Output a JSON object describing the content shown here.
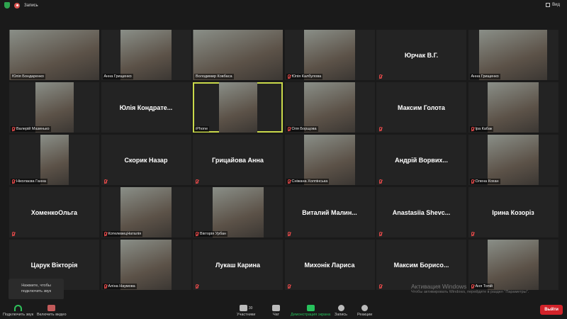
{
  "header": {
    "recording_label": "Запись",
    "view_label": "Вид"
  },
  "tiles": [
    {
      "name": "Юлія Бондаренко",
      "video": true,
      "w": 127,
      "muted": false
    },
    {
      "name": "Анна Грищенко",
      "video": true,
      "w": 72,
      "muted": false
    },
    {
      "name": "Володимир Ковбаса",
      "video": true,
      "w": 127,
      "muted": false
    },
    {
      "name": "Юлія Калбулова",
      "video": true,
      "w": 72,
      "muted": true
    },
    {
      "name": "Юрчак В.Г.",
      "video": false,
      "muted": true
    },
    {
      "name": "Анна Грищенко",
      "video": true,
      "w": 96,
      "muted": false
    },
    {
      "name": "Валерій Мазинько",
      "video": true,
      "w": 54,
      "muted": true
    },
    {
      "name": "Юлія Кондрате...",
      "video": false,
      "muted": false
    },
    {
      "name": "iPhone",
      "video": true,
      "w": 54,
      "muted": false,
      "active": true
    },
    {
      "name": "Оля Борщова",
      "video": true,
      "w": 72,
      "muted": true
    },
    {
      "name": "Максим Голота",
      "video": false,
      "muted": true
    },
    {
      "name": "Іра Кабак",
      "video": true,
      "w": 72,
      "muted": true
    },
    {
      "name": "Ніколаєва Ганна",
      "video": true,
      "w": 40,
      "muted": true
    },
    {
      "name": "Скорик Назар",
      "video": false,
      "muted": true
    },
    {
      "name": "Грицайова Анна",
      "video": false,
      "muted": true
    },
    {
      "name": "Сніжана Холпінська",
      "video": true,
      "w": 72,
      "muted": true
    },
    {
      "name": "Андрій Ворвих...",
      "video": false,
      "muted": true
    },
    {
      "name": "Олена Кохан",
      "video": true,
      "w": 72,
      "muted": true
    },
    {
      "name": "ХоменкоОльга",
      "video": false,
      "muted": true
    },
    {
      "name": "КотелевецНаталія",
      "video": true,
      "w": 72,
      "muted": true
    },
    {
      "name": "Вікторія Урбан",
      "video": true,
      "w": 72,
      "muted": true
    },
    {
      "name": "Виталий Малин...",
      "video": false,
      "muted": true
    },
    {
      "name": "Anastasiia Shevc...",
      "video": false,
      "muted": true
    },
    {
      "name": "Ірина Козоріз",
      "video": false,
      "muted": true
    },
    {
      "name": "Царук Вікторія",
      "video": false,
      "muted": false
    },
    {
      "name": "Аліна Наумова",
      "video": true,
      "w": 72,
      "muted": true
    },
    {
      "name": "Лукаш Карина",
      "video": false,
      "muted": true
    },
    {
      "name": "Михонік Лариса",
      "video": false,
      "muted": true
    },
    {
      "name": "Максим Борисо...",
      "video": false,
      "muted": true
    },
    {
      "name": "Аня Топій",
      "video": true,
      "w": 72,
      "muted": true
    }
  ],
  "tooltip": {
    "line1": "Нажмите, чтобы",
    "line2": "подключить звук"
  },
  "watermark": {
    "title": "Активация Windows",
    "text": "Чтобы активировать Windows, перейдите в раздел \"Параметры\"."
  },
  "toolbar": {
    "audio": "Подключить звук",
    "video": "Включить видео",
    "participants": "Участники",
    "participants_count": "30",
    "chat": "Чат",
    "share": "Демонстрация экрана",
    "record": "Запись",
    "reactions": "Реакции",
    "leave": "Выйти"
  }
}
